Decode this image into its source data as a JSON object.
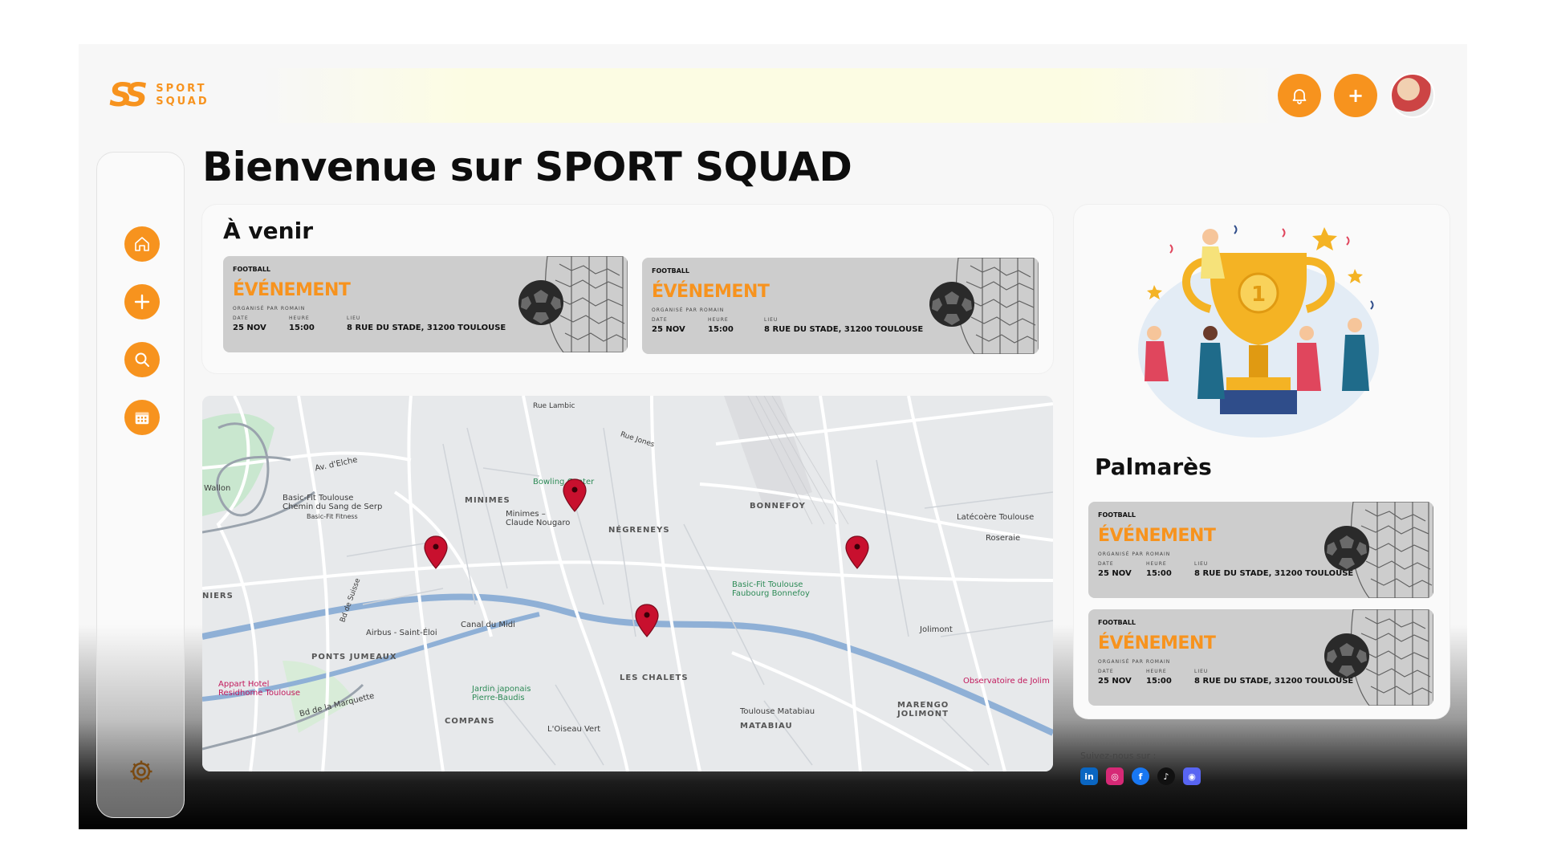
{
  "brand": {
    "logo_mark": "SS",
    "line1": "SPORT",
    "line2": "SQUAD",
    "accent_color": "#f7931e"
  },
  "header": {
    "notifications_icon": "bell-icon",
    "add_icon": "plus-icon",
    "add_label": "+",
    "avatar_icon": "user-avatar"
  },
  "sidebar": {
    "items": [
      {
        "icon": "home-icon"
      },
      {
        "icon": "plus-icon"
      },
      {
        "icon": "search-icon"
      },
      {
        "icon": "calendar-icon"
      }
    ],
    "settings_icon": "gear-icon"
  },
  "page": {
    "title": "Bienvenue sur SPORT SQUAD"
  },
  "upcoming": {
    "title": "À venir",
    "events": [
      {
        "sport": "FOOTBALL",
        "title": "ÉVÉNEMENT",
        "organizer": "ORGANISÉ PAR ROMAIN",
        "date_label": "DATE",
        "date": "25 NOV",
        "time_label": "HEURE",
        "time": "15:00",
        "place_label": "LIEU",
        "place": "8 RUE DU STADE, 31200 TOULOUSE"
      },
      {
        "sport": "FOOTBALL",
        "title": "ÉVÉNEMENT",
        "organizer": "ORGANISÉ PAR ROMAIN",
        "date_label": "DATE",
        "date": "25 NOV",
        "time_label": "HEURE",
        "time": "15:00",
        "place_label": "LIEU",
        "place": "8 RUE DU STADE, 31200 TOULOUSE"
      }
    ]
  },
  "map": {
    "labels": {
      "minimes": "MINIMES",
      "minimes_metro": "Minimes –\nClaude Nougaro",
      "negreneys": "NÉGRENEYS",
      "bonnefoy": "BONNEFOY",
      "niers": "NIERS",
      "ponts_jumeaux": "PONTS JUMEAUX",
      "les_chalets": "LES CHALETS",
      "compans": "COMPANS",
      "matabiau": "MATABIAU",
      "marengo": "MARENGO\nJOLIMONT",
      "basic_fit_serp": "Basic-Fit Toulouse\nChemin du Sang de Serp",
      "basic_fit_fitness": "Basic-Fit Fitness",
      "basic_fit_bonnefoy": "Basic-Fit Toulouse\nFaubourg Bonnefoy",
      "bowling": "Bowling Center",
      "latecoere": "Latécoère Toulouse",
      "roseraie": "Roseraie",
      "jolimont": "Jolimont",
      "canal": "Canal du Midi",
      "airbus": "Airbus - Saint-Éloi",
      "jardin": "Jardin japonais\nPierre-Baudis",
      "oiseau": "L'Oiseau Vert",
      "toulouse_matabiau": "Toulouse Matabiau",
      "observatoire": "Observatoire de Jolim",
      "hotel": "Appart Hotel\nResidhome Toulouse",
      "wallon": "Wallon",
      "rue_lambic": "Rue Lambic",
      "av_elche": "Av. d'Elche",
      "bd_marquette": "Bd de la Marquette",
      "rue_jones": "Rue Jones",
      "bd_suisse": "Bd de Suisse"
    }
  },
  "palmares": {
    "title": "Palmarès",
    "events": [
      {
        "sport": "FOOTBALL",
        "title": "ÉVÉNEMENT",
        "organizer": "ORGANISÉ PAR ROMAIN",
        "date_label": "DATE",
        "date": "25 NOV",
        "time_label": "HEURE",
        "time": "15:00",
        "place_label": "LIEU",
        "place": "8 RUE DU STADE, 31200 TOULOUSE"
      },
      {
        "sport": "FOOTBALL",
        "title": "ÉVÉNEMENT",
        "organizer": "ORGANISÉ PAR ROMAIN",
        "date_label": "DATE",
        "date": "25 NOV",
        "time_label": "HEURE",
        "time": "15:00",
        "place_label": "LIEU",
        "place": "8 RUE DU STADE, 31200 TOULOUSE"
      }
    ]
  },
  "footer": {
    "follow_label": "Suivez-nous sur :",
    "socials": [
      {
        "icon": "linkedin-icon",
        "glyph": "in",
        "color": "#0a66c2"
      },
      {
        "icon": "instagram-icon",
        "glyph": "◎",
        "color": "#d62976"
      },
      {
        "icon": "facebook-icon",
        "glyph": "f",
        "color": "#1877f2"
      },
      {
        "icon": "tiktok-icon",
        "glyph": "♪",
        "color": "#111111"
      },
      {
        "icon": "discord-icon",
        "glyph": "◉",
        "color": "#5865f2"
      }
    ]
  }
}
